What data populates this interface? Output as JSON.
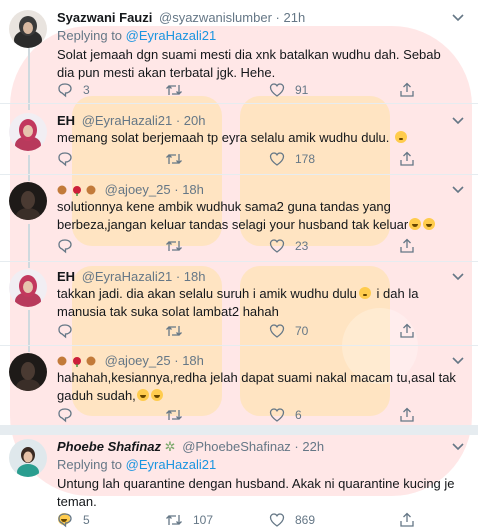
{
  "tweets": [
    {
      "name": "Syazwani Fauzi",
      "handle": "@syazwanislumber",
      "dot": "·",
      "time": "21h",
      "text": "Solat jemaah dgn suami mesti dia xnk batalkan wudhu dah. Sebab dia pun mesti akan terbatal jgk. Hehe.",
      "replies": "3",
      "retweets": "",
      "likes": "91"
    },
    {
      "name": "EH",
      "handle": "@EyraHazali21",
      "dot": "·",
      "time": "20h",
      "text": "memang solat berjemaah tp eyra selalu amik wudhu dulu.",
      "replies": "",
      "retweets": "",
      "likes": "178"
    },
    {
      "name": "",
      "handle": "@ajoey_25",
      "dot": "·",
      "time": "18h",
      "text": "solutionnya kene ambik wudhuk sama2 guna tandas yang berbeza,jangan keluar tandas selagi your husband tak keluar",
      "replies": "",
      "retweets": "",
      "likes": "23"
    },
    {
      "name": "EH",
      "handle": "@EyraHazali21",
      "dot": "·",
      "time": "18h",
      "text_before": "takkan jadi. dia akan selalu suruh i amik wudhu dulu",
      "text_after": " i dah la manusia tak suka solat lambat2 hahah",
      "replies": "",
      "retweets": "",
      "likes": "70"
    },
    {
      "name": "",
      "handle": "@ajoey_25",
      "dot": "·",
      "time": "18h",
      "text": "hahahah,kesiannya,redha jelah dapat suami nakal macam tu,asal tak gaduh sudah,",
      "replies": "",
      "retweets": "",
      "likes": "6"
    },
    {
      "name": "Phoebe Shafinaz",
      "handle": "@PhoebeShafinaz",
      "dot": "·",
      "time": "22h",
      "reply_prefix": "Replying to",
      "reply_mention": "@EyraHazali21",
      "text": "Untung lah quarantine dengan husband. Akak ni quarantine kucing je teman.",
      "replies": "5",
      "retweets": "107",
      "likes": "869"
    }
  ],
  "first_reply": {
    "prefix": "Replying to",
    "mention": "@EyraHazali21"
  },
  "icons": {
    "reply": "reply-icon",
    "retweet": "retweet-icon",
    "like": "heart-icon",
    "share": "share-icon",
    "menu": "chevron-down-icon"
  },
  "colors": {
    "secondary_text": "#657786",
    "link": "#1b95e0",
    "divider": "#e6ecf0",
    "watermark": "#ff3b3b"
  }
}
